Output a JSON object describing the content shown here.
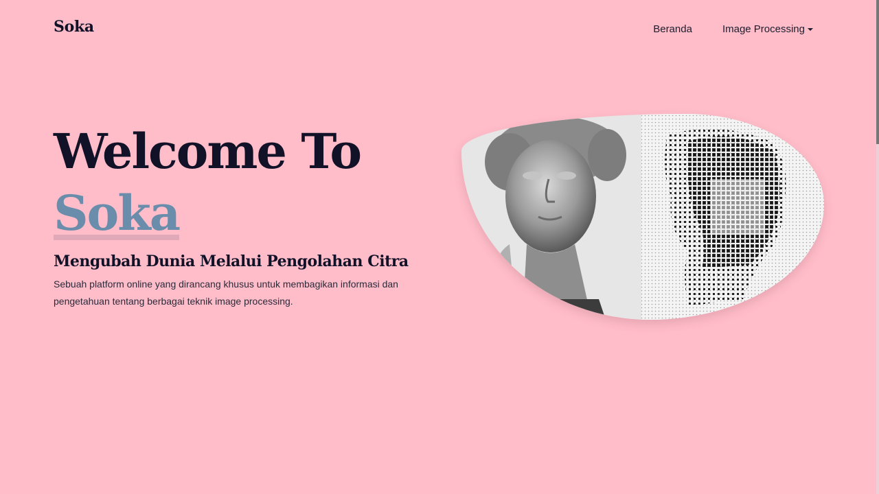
{
  "brand": {
    "name": "Soka"
  },
  "nav": {
    "items": [
      {
        "label": "Beranda",
        "dropdown": false
      },
      {
        "label": "Image Processing",
        "dropdown": true
      }
    ]
  },
  "hero": {
    "title_line1": "Welcome To",
    "title_line2": "Soka",
    "subtitle": "Mengubah Dunia Melalui Pengolahan Citra",
    "description": "Sebuah platform online yang dirancang khusus untuk membagikan informasi dan pengetahuan tentang berbagai teknik image processing."
  },
  "colors": {
    "background": "#FFBDC9",
    "heading": "#111127",
    "accent": "#6a8dab"
  },
  "icons": {
    "dropdown": "caret-down-icon"
  }
}
